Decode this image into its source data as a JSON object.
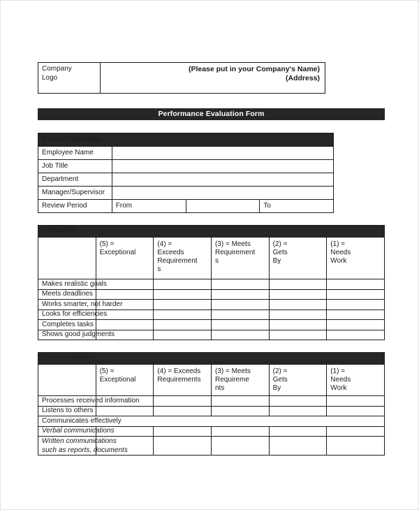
{
  "document": {
    "title": "Performance Evaluation Form"
  },
  "letterhead": {
    "logo_label": "Company\nLogo",
    "logo_label_line1": "Company",
    "logo_label_line2": "Logo",
    "company_name_line": "(Please put in your Company's Name)",
    "address_line": "(Address)"
  },
  "review_information": {
    "section_title": "Review Information",
    "rows": [
      {
        "label": "Employee Name",
        "value": ""
      },
      {
        "label": "Job Title",
        "value": ""
      },
      {
        "label": "Department",
        "value": ""
      },
      {
        "label": "Manager/Supervisor",
        "value": ""
      }
    ],
    "review_period": {
      "label": "Review Period",
      "from_label": "From",
      "from_value": "",
      "to_label": "To",
      "to_value": ""
    }
  },
  "productivity": {
    "section_title": "Productivity",
    "rating_columns": [
      {
        "line1": "(5) =",
        "line2": "Exceptional",
        "line3": "",
        "line4": ""
      },
      {
        "line1": "(4) =",
        "line2": "Exceeds",
        "line3": "Requirement",
        "line4": "s"
      },
      {
        "line1": "(3) = Meets",
        "line2": "Requirement",
        "line3": "s",
        "line4": ""
      },
      {
        "line1": "(2) =",
        "line2": "Gets",
        "line3": "By",
        "line4": ""
      },
      {
        "line1": "(1) =",
        "line2": "Needs",
        "line3": "Work",
        "line4": ""
      }
    ],
    "criteria": [
      "Makes realistic goals",
      "Meets deadlines",
      "Works smarter, not harder",
      "Looks for efficiencies",
      "Completes tasks",
      "Shows good judgments"
    ]
  },
  "communication": {
    "section_title": "Communication",
    "rating_columns": [
      {
        "line1": "(5) =",
        "line2": "Exceptional",
        "line3": "",
        "line4": ""
      },
      {
        "line1": "(4) = Exceeds",
        "line2": "Requirements",
        "line3": "",
        "line4": ""
      },
      {
        "line1": "(3) = Meets",
        "line2": "Requireme",
        "line3": "nts",
        "line4": ""
      },
      {
        "line1": "(2) =",
        "line2": "Gets",
        "line3": "By",
        "line4": ""
      },
      {
        "line1": "(1) =",
        "line2": "Needs",
        "line3": "Work",
        "line4": ""
      }
    ],
    "criteria": [
      "Processes received information",
      "Listens to others"
    ],
    "group_heading": "Communicates effectively",
    "sub_items": [
      {
        "line1": "Verbal communications",
        "line2": ""
      },
      {
        "line1": "Written communications",
        "line2": "such as reports, documents"
      }
    ]
  },
  "colors": {
    "banner_background": "#262626",
    "banner_text": "#ffffff",
    "border": "#1c1c1c",
    "page_background": "#ffffff",
    "text": "#1b1b1b"
  }
}
